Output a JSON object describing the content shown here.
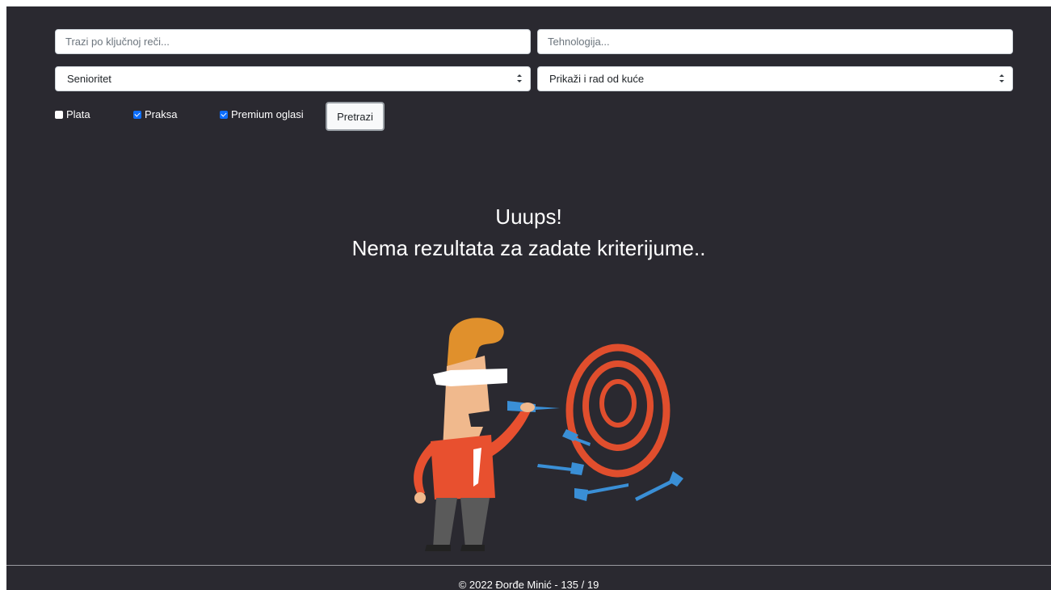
{
  "search": {
    "keyword_placeholder": "Trazi po ključnoj reči...",
    "technology_placeholder": "Tehnologija...",
    "seniority_selected": "Senioritet",
    "remote_selected": "Prikaži i rad od kuće"
  },
  "filters": {
    "plata": {
      "label": "Plata",
      "checked": false
    },
    "praksa": {
      "label": "Praksa",
      "checked": true
    },
    "premium": {
      "label": "Premium oglasi",
      "checked": true
    },
    "search_button": "Pretrazi"
  },
  "empty_state": {
    "title": "Uuups!",
    "message": "Nema rezultata za zadate kriterijume..",
    "illustration": "blindfolded-man-throwing-darts"
  },
  "footer": {
    "text": "© 2022 Đorđe Minić - 135 / 19"
  },
  "colors": {
    "background": "#2a2930",
    "target_red": "#e04e2d",
    "dart_blue": "#3a8fd6",
    "checkbox_blue": "#0d6efd"
  }
}
